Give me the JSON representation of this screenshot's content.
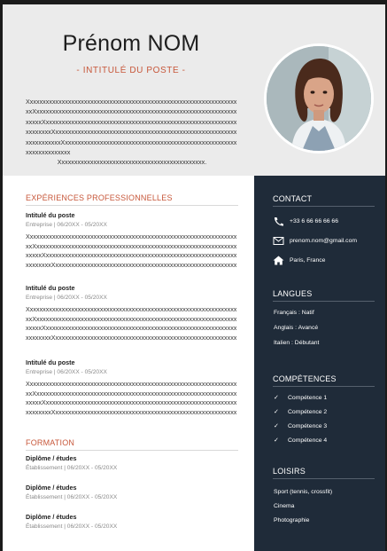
{
  "header": {
    "name": "Prénom NOM",
    "job_title": "- INTITULÉ DU POSTE -",
    "intro_text": "XxxxxxxxxxxxxxxxxxxxxxxxxxxxxxxxxxxxxxxxxxxxxxxxxxxxxxxxxxxxxxxxxxxxXxxxxxxxxxxxxxxxxxxxxxxxxxxxxxxxxxxxxxxxxxxxxxxxxxxxxxxxxxxxxxxxxxxxxXxxxxxxxxxxxxxxxxxxxxxxxxxxxxxxxxxxxxxxxxxxxxxxxxxxxxxxxxxxxxxxxxxxxxXxxxxxxxxxxxxxxxxxxxxxxxxxxxxxxxxxxxxxxxxxxxxxxxxxxxxxxxxxxxxxxxxxxxxXxxxxxxxxxxxxxxxxxxxxxxxxxxxxxxxxxxxxxxxxxxxxxxxxxxxxxxxxxxxxxxxxxxxx",
    "intro_last": "Xxxxxxxxxxxxxxxxxxxxxxxxxxxxxxxxxxxxxxxxxxxxxx."
  },
  "experience": {
    "title": "EXPÉRIENCES PROFESSIONNELLES",
    "jobs": [
      {
        "title": "Intitulé du poste",
        "meta": "Entreprise | 06/20XX - 05/20XX",
        "desc": "XxxxxxxxxxxxxxxxxxxxxxxxxxxxxxxxxxxxxxxxxxxxxxxxxxxxxxxxxxxxxxxxxxxxXxxxxxxxxxxxxxxxxxxxxxxxxxxxxxxxxxxxxxxxxxxxxxxxxxxxxxxxxxxxxxxxxxxxxXxxxxxxxxxxxxxxxxxxxxxxxxxxxxxxxxxxxxxxxxxxxxxxxxxxxxxxxxxxxxxxxxxxxxXxxxxxxxxxxxxxxxxxxxxxxxxxxxxxxxxxxxxxxxxxxxxxxxxxxxxxxxxxxxxxxxxxxxx"
      },
      {
        "title": "Intitulé du poste",
        "meta": "Entreprise | 06/20XX - 05/20XX",
        "desc": "XxxxxxxxxxxxxxxxxxxxxxxxxxxxxxxxxxxxxxxxxxxxxxxxxxxxxxxxxxxxxxxxxxxxXxxxxxxxxxxxxxxxxxxxxxxxxxxxxxxxxxxxxxxxxxxxxxxxxxxxxxxxxxxxxxxxxxxxxXxxxxxxxxxxxxxxxxxxxxxxxxxxxxxxxxxxxxxxxxxxxxxxxxxxxxxxxxxxxxxxxxxxxxXxxxxxxxxxxxxxxxxxxxxxxxxxxxxxxxxxxxxxxxxxxxxxxxxxxxxxxxxxxxxxxxxxxxx"
      },
      {
        "title": "Intitulé du poste",
        "meta": "Entreprise | 06/20XX - 05/20XX",
        "desc": "XxxxxxxxxxxxxxxxxxxxxxxxxxxxxxxxxxxxxxxxxxxxxxxxxxxxxxxxxxxxxxxxxxxxXxxxxxxxxxxxxxxxxxxxxxxxxxxxxxxxxxxxxxxxxxxxxxxxxxxxxxxxxxxxxxxxxxxxxXxxxxxxxxxxxxxxxxxxxxxxxxxxxxxxxxxxxxxxxxxxxxxxxxxxxxxxxxxxxxxxxxxxxxXxxxxxxxxxxxxxxxxxxxxxxxxxxxxxxxxxxxxxxxxxxxxxxxxxxxxxxxxxxxxxxxxxxxx"
      }
    ]
  },
  "education": {
    "title": "FORMATION",
    "items": [
      {
        "title": "Diplôme / études",
        "meta": "Établissement | 06/20XX - 05/20XX"
      },
      {
        "title": "Diplôme / études",
        "meta": "Établissement | 06/20XX - 05/20XX"
      },
      {
        "title": "Diplôme / études",
        "meta": "Établissement | 06/20XX - 05/20XX"
      }
    ]
  },
  "contact": {
    "title": "CONTACT",
    "phone": "+33 6 66 66 66 66",
    "email": "prenom.nom@gmail.com",
    "location": "Paris, France"
  },
  "languages": {
    "title": "LANGUES",
    "items": [
      "Français : Natif",
      "Anglais : Avancé",
      "Italien : Débutant"
    ]
  },
  "skills": {
    "title": "COMPÉTENCES",
    "items": [
      "Compétence 1",
      "Compétence 2",
      "Compétence 3",
      "Compétence 4"
    ]
  },
  "hobbies": {
    "title": "LOISIRS",
    "items": [
      "Sport (tennis, crossfit)",
      "Cinema",
      "Photographie"
    ]
  },
  "colors": {
    "accent": "#c7573a",
    "sidebar": "#1f2b39",
    "header_bg": "#ebebeb"
  },
  "icons": {
    "phone": "phone-icon",
    "email": "envelope-icon",
    "location": "home-icon",
    "skill": "check-icon"
  }
}
